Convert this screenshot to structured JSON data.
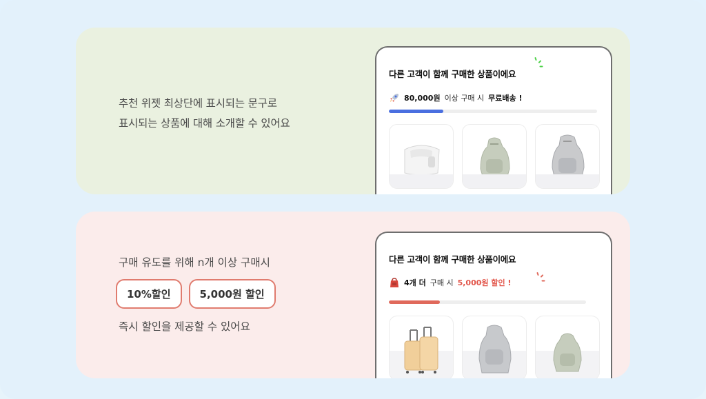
{
  "colors": {
    "green_bg": "#eaf1e0",
    "pink_bg": "#fbeceb",
    "blue_progress": "#4a6fe0",
    "red_progress": "#e0695b",
    "red_text": "#e2554a",
    "chip_border": "#e07b6e"
  },
  "top_card": {
    "description_line1": "추천 위젯 최상단에 표시되는 문구로",
    "description_line2": "표시되는 상품에 대해 소개할 수 있어요",
    "widget": {
      "title": "다른 고객이 함께 구매한 상품이에요",
      "icon": "rocket-icon",
      "amount": "80,000원",
      "middle_text": "이상 구매 시",
      "benefit": "무료배송 !",
      "progress": 0.26,
      "products": [
        "white-tote-bag-image",
        "olive-backpack-image",
        "gray-backpack-image"
      ]
    }
  },
  "bottom_card": {
    "line1": "구매 유도를 위해 n개 이상 구매시",
    "chips": [
      "10%할인",
      "5,000원 할인"
    ],
    "line2": "즉시 할인을 제공할 수 있어요",
    "widget": {
      "title": "다른 고객이 함께 구매한 상품이에요",
      "icon": "red-bag-icon",
      "count": "4개 더",
      "middle_text": "구매 시",
      "benefit": "5,000원 할인 !",
      "progress": 0.26,
      "products": [
        "suitcase-set-image",
        "gray-backpack-image",
        "olive-backpack-image"
      ]
    }
  }
}
